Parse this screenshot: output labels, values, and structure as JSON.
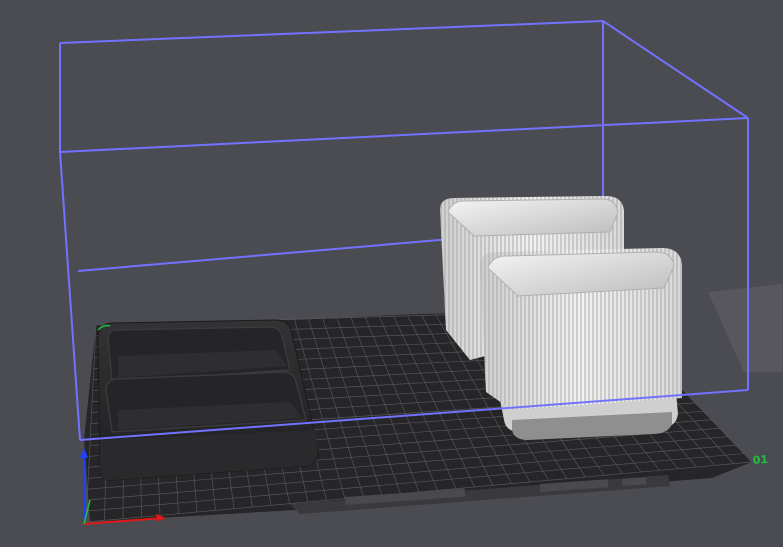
{
  "viewport": {
    "background": "#4b4b52",
    "bed_color": "#262628",
    "grid_color": "#55555a",
    "volume_color": "#7272ff"
  },
  "bed": {
    "label_text": "",
    "edge_number": "01"
  },
  "axes": {
    "x_color": "#e01818",
    "y_color": "#20c040",
    "z_color": "#2040ff"
  },
  "objects": [
    {
      "name": "tray-top",
      "color": "#2c2c2e"
    },
    {
      "name": "tray-bottom",
      "color": "#2c2c2e"
    },
    {
      "name": "planter-back",
      "color": "#e8e8e8"
    },
    {
      "name": "planter-front",
      "color": "#e8e8e8"
    }
  ]
}
